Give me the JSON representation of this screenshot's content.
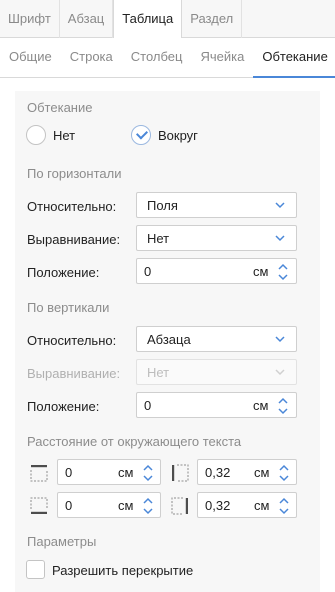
{
  "top_tabs": [
    "Шрифт",
    "Абзац",
    "Таблица",
    "Раздел"
  ],
  "top_tab_active": 2,
  "sub_tabs": [
    "Общие",
    "Строка",
    "Столбец",
    "Ячейка",
    "Обтекание"
  ],
  "sub_tab_active": 4,
  "accent_color": "#4a87d8",
  "wrapping": {
    "title": "Обтекание",
    "options": [
      {
        "label": "Нет",
        "checked": false
      },
      {
        "label": "Вокруг",
        "checked": true
      }
    ]
  },
  "horizontal": {
    "title": "По горизонтали",
    "relative_label": "Относительно:",
    "relative_value": "Поля",
    "align_label": "Выравнивание:",
    "align_value": "Нет",
    "position_label": "Положение:",
    "position_value": "0",
    "position_unit": "см"
  },
  "vertical": {
    "title": "По вертикали",
    "relative_label": "Относительно:",
    "relative_value": "Абзаца",
    "align_label": "Выравнивание:",
    "align_value": "Нет",
    "align_disabled": true,
    "position_label": "Положение:",
    "position_value": "0",
    "position_unit": "см"
  },
  "distance": {
    "title": "Расстояние от окружающего текста",
    "top": {
      "icon": "margin-top-icon",
      "value": "0",
      "unit": "см"
    },
    "left": {
      "icon": "margin-left-icon",
      "value": "0,32",
      "unit": "см"
    },
    "bottom": {
      "icon": "margin-bottom-icon",
      "value": "0",
      "unit": "см"
    },
    "right": {
      "icon": "margin-right-icon",
      "value": "0,32",
      "unit": "см"
    }
  },
  "params": {
    "title": "Параметры",
    "allow_overlap_label": "Разрешить перекрытие",
    "allow_overlap_checked": false
  }
}
